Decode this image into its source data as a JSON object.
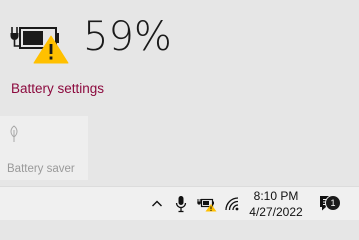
{
  "battery": {
    "percent_label": "59%",
    "level": 0.59,
    "warning": true
  },
  "links": {
    "battery_settings": "Battery settings"
  },
  "quick_action": {
    "label": "Battery saver",
    "state": "off"
  },
  "tray": {
    "time": "8:10 PM",
    "date": "4/27/2022",
    "notification_count": "1",
    "icons": [
      "chevron-up-icon",
      "microphone-icon",
      "battery-warning-icon",
      "wifi-icon",
      "notification-center-icon"
    ]
  },
  "colors": {
    "accent_link": "#8c0a3e",
    "warning_yellow": "#ffc000",
    "flyout_bg": "#e6e6e6",
    "taskbar_bg": "#f0f0f0"
  }
}
